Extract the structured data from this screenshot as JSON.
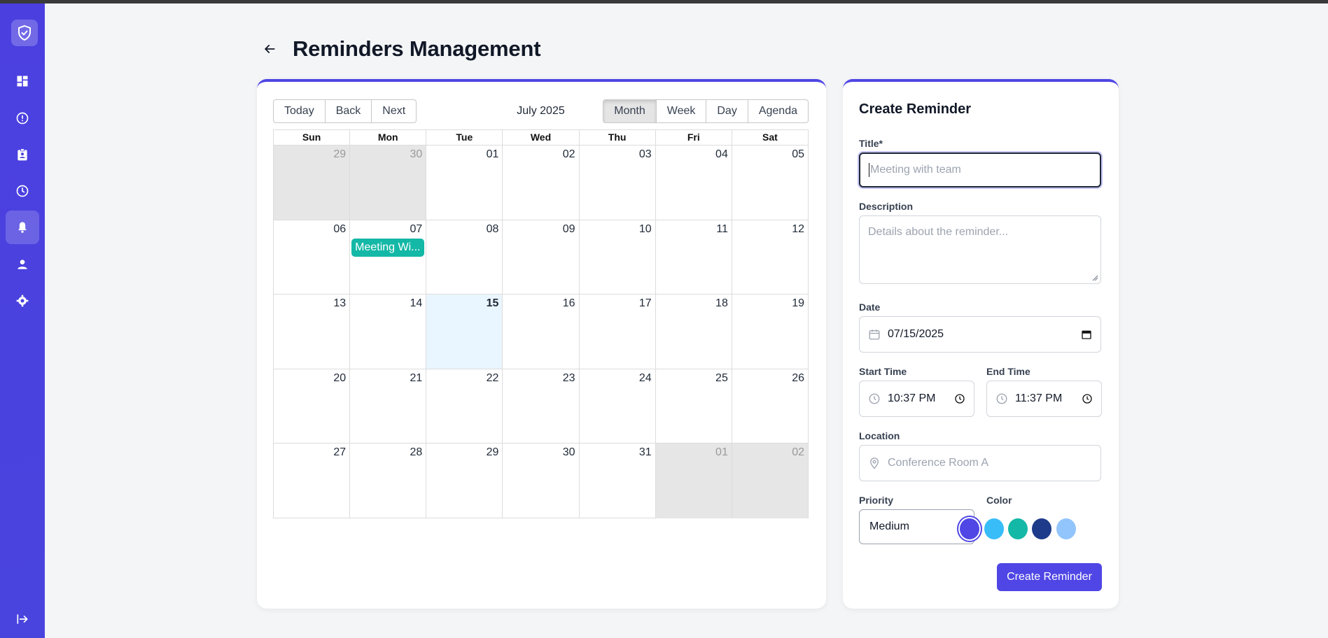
{
  "page": {
    "title": "Reminders Management"
  },
  "sidebar": {
    "items": [
      {
        "name": "dashboard-icon"
      },
      {
        "name": "alert-icon"
      },
      {
        "name": "clipboard-user-icon"
      },
      {
        "name": "clock-icon"
      },
      {
        "name": "bell-icon",
        "active": true
      },
      {
        "name": "user-icon"
      },
      {
        "name": "settings-icon"
      },
      {
        "name": "logout-icon"
      }
    ]
  },
  "calendar": {
    "nav": {
      "today": "Today",
      "back": "Back",
      "next": "Next"
    },
    "label": "July 2025",
    "views": {
      "month": "Month",
      "week": "Week",
      "day": "Day",
      "agenda": "Agenda",
      "active": "Month"
    },
    "weekdays": [
      "Sun",
      "Mon",
      "Tue",
      "Wed",
      "Thu",
      "Fri",
      "Sat"
    ],
    "weeks": [
      [
        {
          "d": "29",
          "off": true
        },
        {
          "d": "30",
          "off": true
        },
        {
          "d": "01"
        },
        {
          "d": "02"
        },
        {
          "d": "03"
        },
        {
          "d": "04"
        },
        {
          "d": "05"
        }
      ],
      [
        {
          "d": "06"
        },
        {
          "d": "07",
          "event": "Meeting Wi..."
        },
        {
          "d": "08"
        },
        {
          "d": "09"
        },
        {
          "d": "10"
        },
        {
          "d": "11"
        },
        {
          "d": "12"
        }
      ],
      [
        {
          "d": "13"
        },
        {
          "d": "14"
        },
        {
          "d": "15",
          "today": true
        },
        {
          "d": "16"
        },
        {
          "d": "17"
        },
        {
          "d": "18"
        },
        {
          "d": "19"
        }
      ],
      [
        {
          "d": "20"
        },
        {
          "d": "21"
        },
        {
          "d": "22"
        },
        {
          "d": "23"
        },
        {
          "d": "24"
        },
        {
          "d": "25"
        },
        {
          "d": "26"
        }
      ],
      [
        {
          "d": "27"
        },
        {
          "d": "28"
        },
        {
          "d": "29"
        },
        {
          "d": "30"
        },
        {
          "d": "31"
        },
        {
          "d": "01",
          "off": true
        },
        {
          "d": "02",
          "off": true
        }
      ]
    ],
    "event_color": "#14b8a6"
  },
  "form": {
    "title": "Create Reminder",
    "title_label": "Title*",
    "title_placeholder": "Meeting with team",
    "description_label": "Description",
    "description_placeholder": "Details about the reminder...",
    "date_label": "Date",
    "date_value": "07/15/2025",
    "start_label": "Start Time",
    "start_value": "10:37 PM",
    "end_label": "End Time",
    "end_value": "11:37 PM",
    "location_label": "Location",
    "location_placeholder": "Conference Room A",
    "priority_label": "Priority",
    "priority_value": "Medium",
    "color_label": "Color",
    "colors": [
      "#4f46e5",
      "#38bdf8",
      "#14b8a6",
      "#1e3a8a",
      "#93c5fd"
    ],
    "selected_color": "#4f46e5",
    "submit": "Create Reminder"
  }
}
